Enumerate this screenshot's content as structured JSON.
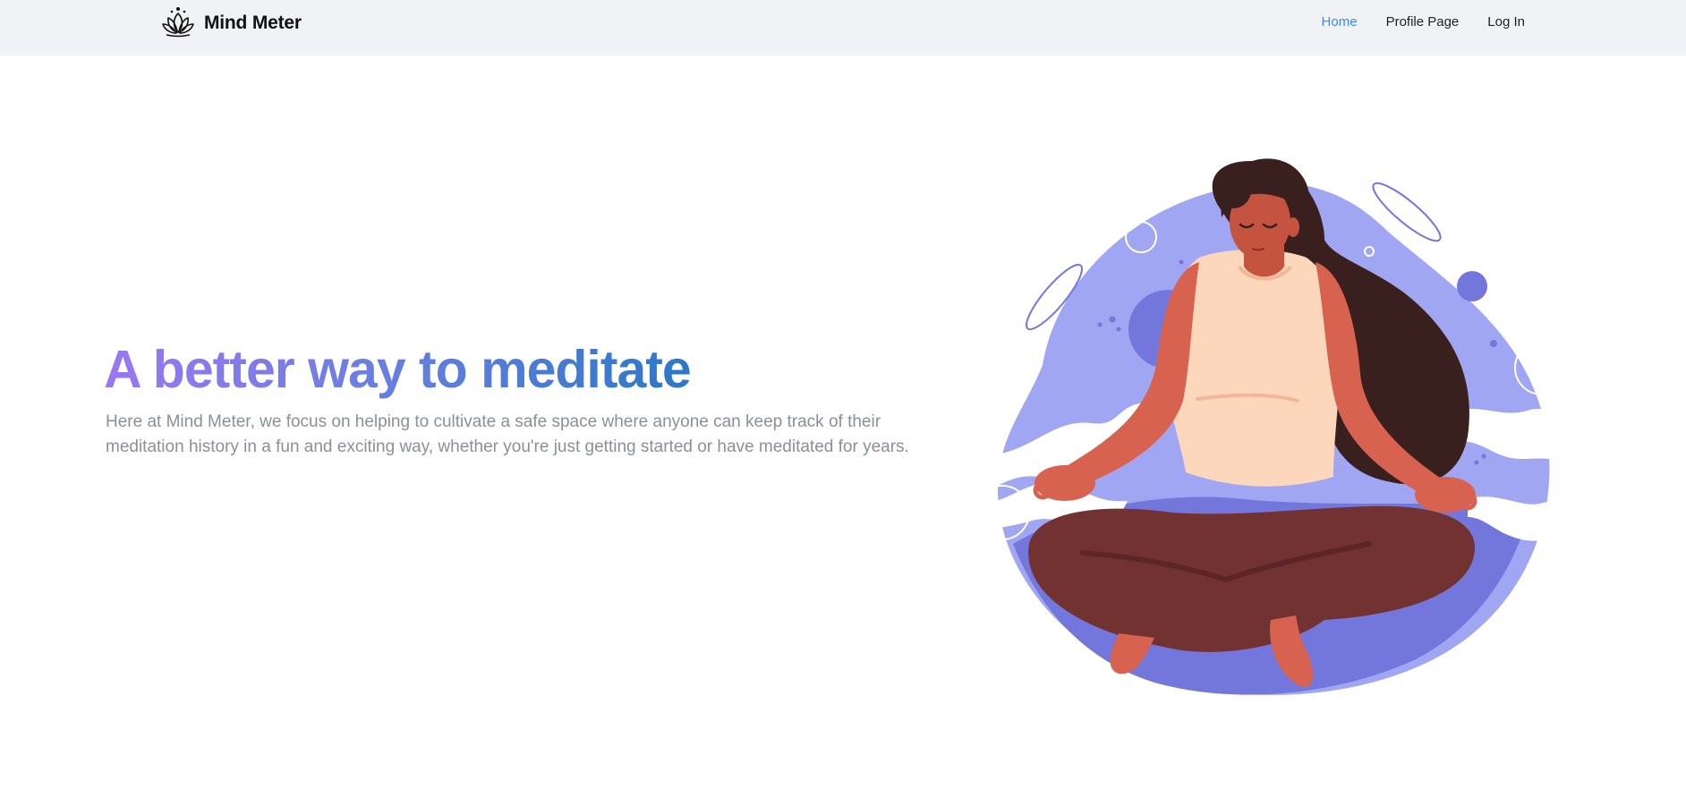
{
  "brand": {
    "name": "Mind Meter",
    "logo_icon": "lotus-icon"
  },
  "nav": {
    "items": [
      {
        "label": "Home",
        "active": true
      },
      {
        "label": "Profile Page",
        "active": false
      },
      {
        "label": "Log In",
        "active": false
      }
    ]
  },
  "hero": {
    "title": "A better way to meditate",
    "description": "Here at Mind Meter, we focus on helping to cultivate a safe space where anyone can keep track of their meditation history in a fun and exciting way, whether you're just getting started or have meditated for years.",
    "illustration_icon": "meditating-woman-illustration"
  },
  "colors": {
    "nav_background": "#f1f2f6",
    "nav_active": "#3d8bf0",
    "title_gradient_start": "#9a77f2",
    "title_gradient_end": "#2d78c6",
    "body_text": "#8a8f9c",
    "illustration_blob": "#a0a6f2",
    "illustration_accent": "#7377dc"
  }
}
